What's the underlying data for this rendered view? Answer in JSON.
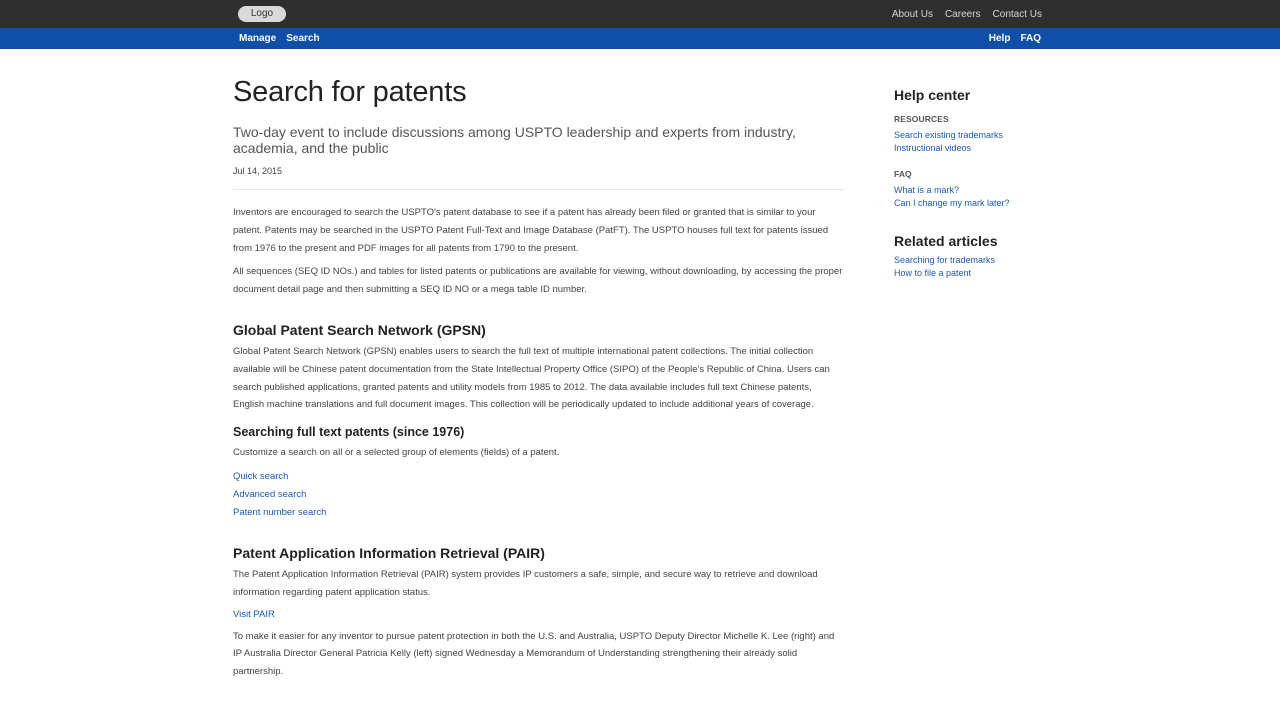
{
  "topbar": {
    "logo_label": "Logo",
    "links": [
      "About Us",
      "Careers",
      "Contact Us"
    ]
  },
  "navbar": {
    "left": [
      "Manage",
      "Search"
    ],
    "right": [
      "Help",
      "FAQ"
    ]
  },
  "main": {
    "title": "Search for patents",
    "subtitle": "Two-day event to include discussions among USPTO leadership and experts from industry, academia, and the public",
    "date": "Jul 14, 2015",
    "intro": [
      "Inventors are encouraged to search the USPTO's patent database to see if a patent has already been filed or granted that is similar to your patent. Patents may be searched in the USPTO Patent Full-Text and Image Database (PatFT). The USPTO houses full text for patents issued from 1976 to the present and PDF images for all patents from 1790 to the present.",
      "All sequences (SEQ ID NOs.) and tables for listed patents or publications are available for viewing, without downloading, by accessing the proper document detail page and then submitting a SEQ ID NO or a mega table ID number."
    ],
    "gpsn": {
      "heading": "Global Patent Search Network (GPSN)",
      "text": "Global Patent Search Network (GPSN) enables users to search the full text of multiple international patent collections. The initial collection available will be Chinese patent documentation from the State Intellectual Property Office (SIPO) of the People's Republic of China. Users can search published applications, granted patents and utility models from 1985 to 2012. The data available includes full text Chinese patents, English machine translations and full document images. This collection will be periodically updated to include additional years of coverage."
    },
    "fulltext": {
      "heading": "Searching full text patents (since 1976)",
      "text": "Customize a search on all or a selected group of elements (fields) of a patent.",
      "links": [
        "Quick search",
        "Advanced search",
        "Patent number search"
      ]
    },
    "pair": {
      "heading": "Patent Application Information Retrieval (PAIR)",
      "text": "The Patent Application Information Retrieval (PAIR) system provides IP customers a safe, simple, and secure way to retrieve and download information regarding patent application status.",
      "link": "Visit PAIR",
      "text2": "To make it easier for any inventor to pursue patent protection in both the U.S. and Australia, USPTO Deputy Director Michelle K. Lee (right) and IP Australia Director General Patricia Kelly (left) signed Wednesday a Memorandum of Understanding strengthening their already solid partnership."
    }
  },
  "sidebar": {
    "help_heading": "Help center",
    "resources_label": "RESOURCES",
    "resources_links": [
      "Search existing trademarks",
      "Instructional videos"
    ],
    "faq_label": "FAQ",
    "faq_links": [
      "What is a mark?",
      "Can I change my mark later?"
    ],
    "related_heading": "Related articles",
    "related_links": [
      "Searching for trademarks",
      "How to file a patent"
    ]
  }
}
